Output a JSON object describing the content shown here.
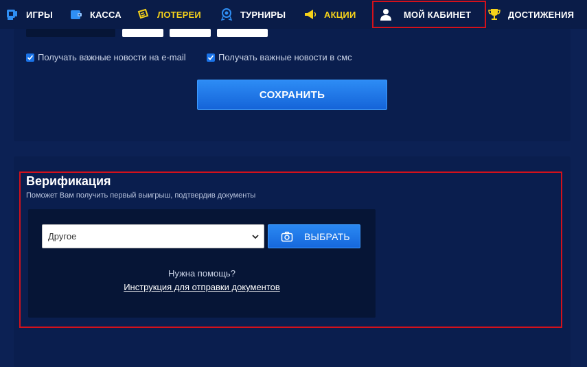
{
  "nav": {
    "items": [
      {
        "label": "ИГРЫ",
        "icon": "games-icon"
      },
      {
        "label": "КАССА",
        "icon": "wallet-icon"
      },
      {
        "label": "ЛОТЕРЕИ",
        "icon": "tickets-icon",
        "color": "#f6d21a"
      },
      {
        "label": "ТУРНИРЫ",
        "icon": "medal-icon"
      },
      {
        "label": "АКЦИИ",
        "icon": "megaphone-icon",
        "color": "#f6d21a"
      },
      {
        "label": "МОЙ КАБИНЕТ",
        "icon": "user-icon",
        "active": true
      },
      {
        "label": "ДОСТИЖЕНИЯ",
        "icon": "trophy-icon",
        "color": "#f6d21a"
      }
    ]
  },
  "profile": {
    "checkbox_email": {
      "label": "Получать важные новости на e-mail",
      "checked": true
    },
    "checkbox_sms": {
      "label": "Получать важные новости в смс",
      "checked": true
    },
    "save_label": "СОХРАНИТЬ"
  },
  "verification": {
    "title": "Верификация",
    "subtitle": "Поможет Вам получить первый выигрыш, подтвердив документы",
    "select_value": "Другое",
    "choose_label": "ВЫБРАТЬ",
    "help_text": "Нужна помощь?",
    "help_link": "Инструкция для отправки документов"
  },
  "colors": {
    "accent": "#1a73e8",
    "highlight": "#d3111b",
    "yellow": "#f6d21a",
    "background": "#0c2154"
  }
}
